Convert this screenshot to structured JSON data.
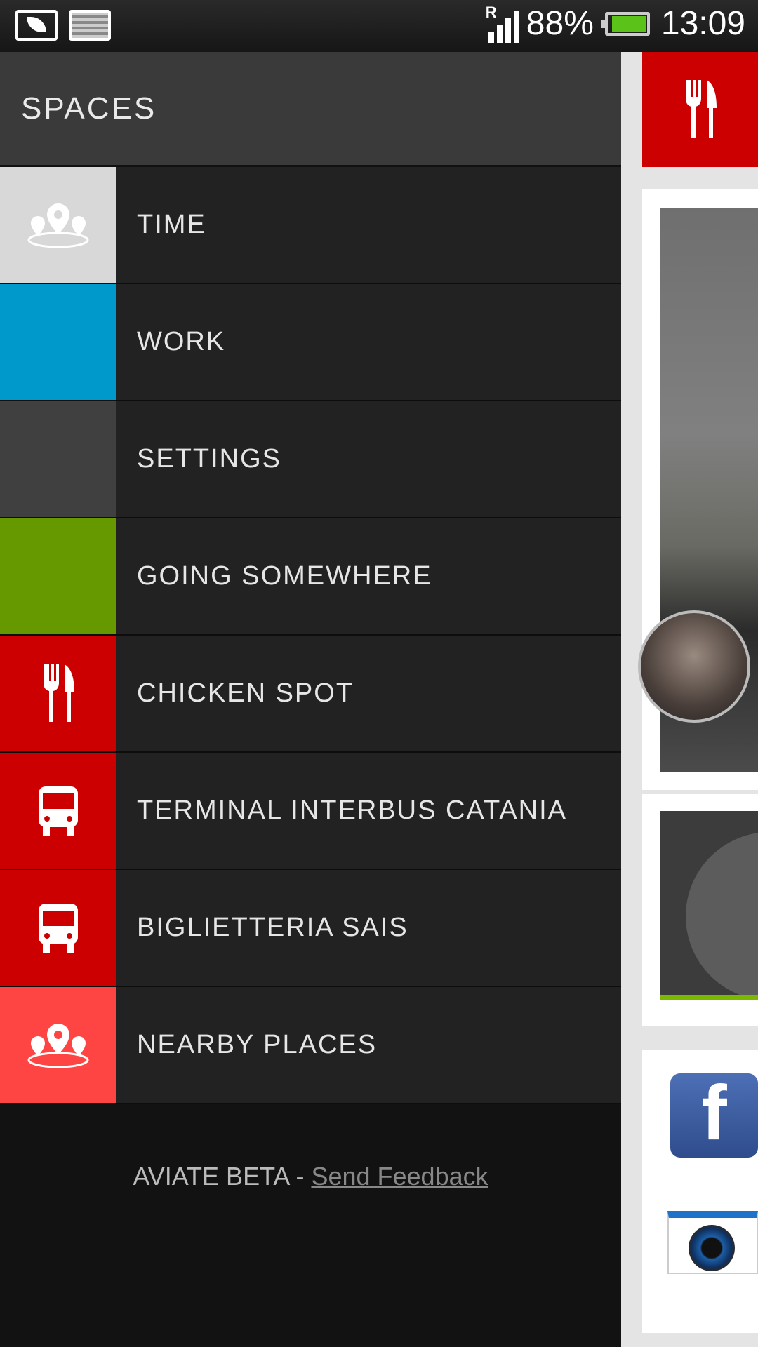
{
  "status_bar": {
    "roaming": "R",
    "battery_percent": "88%",
    "time": "13:09",
    "battery_color": "#5bc21a"
  },
  "drawer": {
    "title": "SPACES",
    "items": [
      {
        "label": "TIME",
        "color": "#d8d8d8",
        "icon": "places-pin-icon"
      },
      {
        "label": "WORK",
        "color": "#0099cc",
        "icon": ""
      },
      {
        "label": "SETTINGS",
        "color": "#404040",
        "icon": ""
      },
      {
        "label": "GOING SOMEWHERE",
        "color": "#669900",
        "icon": ""
      },
      {
        "label": "CHICKEN SPOT",
        "color": "#cc0000",
        "icon": "fork-knife-icon"
      },
      {
        "label": "TERMINAL INTERBUS CATANIA",
        "color": "#cc0000",
        "icon": "bus-icon"
      },
      {
        "label": "BIGLIETTERIA SAIS",
        "color": "#cc0000",
        "icon": "bus-icon"
      },
      {
        "label": "NEARBY PLACES",
        "color": "#ff4444",
        "icon": "places-pin-icon"
      }
    ],
    "footer": {
      "brand": "AVIATE BETA",
      "separator": " - ",
      "link": "Send Feedback"
    }
  }
}
